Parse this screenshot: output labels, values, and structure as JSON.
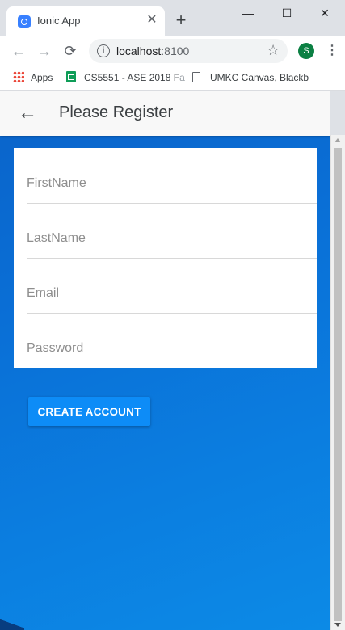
{
  "browser": {
    "tab": {
      "title": "Ionic App",
      "close_glyph": "✕"
    },
    "new_tab_glyph": "+",
    "window_controls": {
      "minimize": "—",
      "maximize": "☐",
      "close": "✕"
    },
    "nav": {
      "back": "←",
      "forward": "→",
      "reload": "⟳"
    },
    "address": {
      "host": "localhost",
      "port": ":8100"
    },
    "profile_initial": "S",
    "bookmarks": [
      {
        "label": "Apps",
        "icon": "apps-grid-icon"
      },
      {
        "label": "CS5551 - ASE 2018 F",
        "fade": "a",
        "icon": "sheets-icon"
      },
      {
        "label": "UMKC Canvas, Blackb",
        "fade": "",
        "icon": "document-icon"
      }
    ]
  },
  "app": {
    "header": {
      "title": "Please Register",
      "back_icon": "arrow-back-icon"
    },
    "form": {
      "fields": [
        {
          "placeholder": "FirstName",
          "value": ""
        },
        {
          "placeholder": "LastName",
          "value": ""
        },
        {
          "placeholder": "Email",
          "value": ""
        },
        {
          "placeholder": "Password",
          "value": ""
        }
      ],
      "submit_label": "CREATE ACCOUNT"
    }
  },
  "colors": {
    "accent": "#0d8cf7",
    "background": "#0a6fd6",
    "header": "#f8f8f8"
  }
}
